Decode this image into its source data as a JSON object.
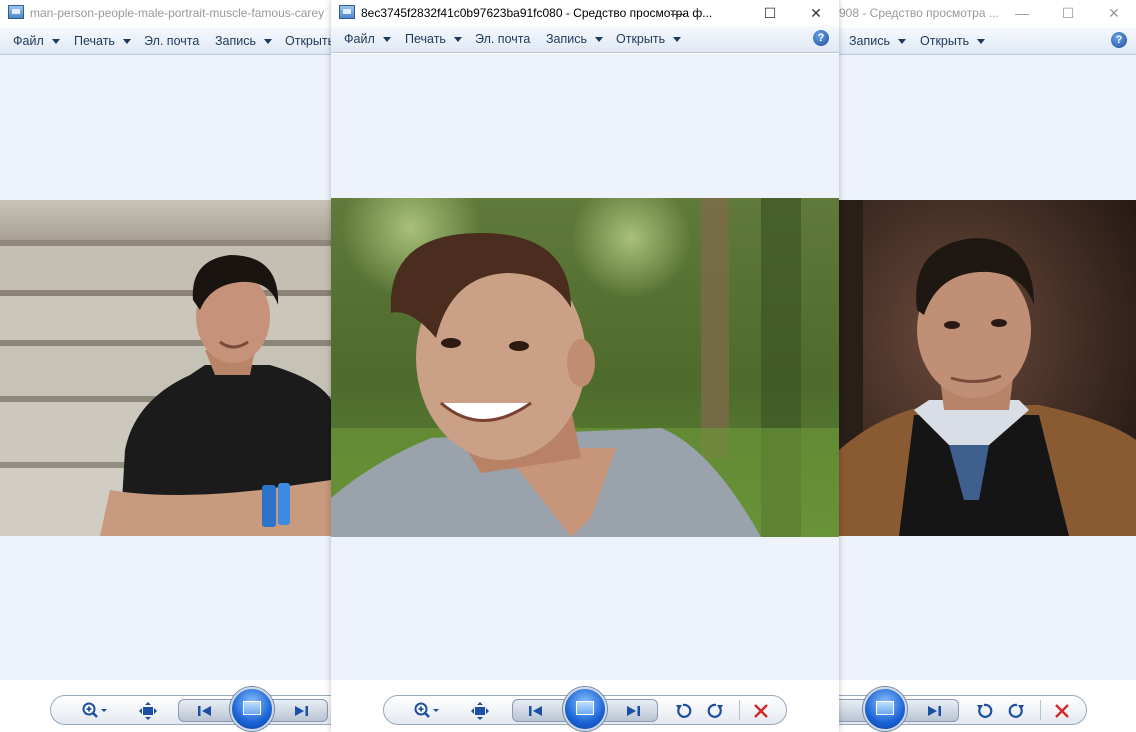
{
  "windows": {
    "left": {
      "title": "man-person-people-male-portrait-muscle-famous-carey",
      "menu": [
        "Файл",
        "Печать",
        "Эл. почта",
        "Запись",
        "Открыть"
      ]
    },
    "center": {
      "title": "8ec3745f2832f41c0b97623ba91fc080 - Средство просмотра ф...",
      "menu": [
        "Файл",
        "Печать",
        "Эл. почта",
        "Запись",
        "Открыть"
      ],
      "help_label": "?"
    },
    "right": {
      "title": "908 - Средство просмотра ...",
      "menu": [
        "Запись",
        "Открыть"
      ],
      "help_label": "?"
    }
  },
  "caption_glyphs": {
    "minimize": "—",
    "maximize": "☐",
    "close": "✕"
  },
  "icons": [
    "app-icon",
    "zoom-icon",
    "fit-to-window-icon",
    "previous-icon",
    "slideshow-icon",
    "next-icon",
    "rotate-counterclockwise-icon",
    "rotate-clockwise-icon",
    "delete-icon",
    "help-icon"
  ],
  "colors": {
    "viewer_bg": "#eef2fa",
    "toolbar_blue": "#1c4fa3",
    "delete_red": "#d22a2a"
  }
}
